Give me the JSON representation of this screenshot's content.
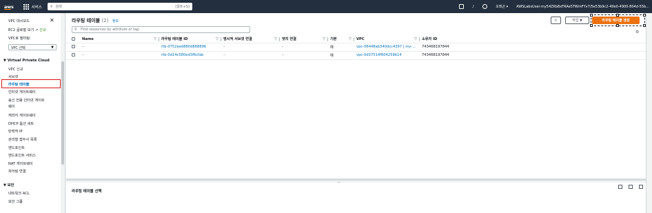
{
  "topbar": {
    "logo": "aws",
    "services_label": "서비스",
    "search_placeholder": "검색",
    "search_shortcut": "[알트+S]",
    "region": "오레곤 ▾",
    "account": "AWSLabsUser-my54ZKb8xFRAe5TWmFYv7/5e53b9c2-49e0-4900-804d-55b..."
  },
  "sidebar": {
    "vpc_dashboard": "VPC 대시보드",
    "ec2_global_view": "EC2 글로벌 보기",
    "new_badge": "신규",
    "filter_label": "VPC로 필터링:",
    "filter_value": "VPC 선택",
    "section_vpc": "Virtual Private Cloud",
    "items": [
      "VPC 신규",
      "서브넷",
      "라우팅 테이블",
      "인터넷 게이트웨이",
      "송신 전용 인터넷 게이트",
      "웨이",
      "캐리어 게이트웨이",
      "DHCP 옵션 세트",
      "탄력적 IP",
      "관리형 접두사 목록",
      "엔드포인트",
      "엔드포인트 서비스",
      "NAT 게이트웨이",
      "피어링 연결"
    ],
    "section_security": "보안",
    "security_items": [
      "네트워크 ACL",
      "보안 그룹"
    ]
  },
  "main": {
    "title": "라우팅 테이블",
    "count": "(2)",
    "info": "정보",
    "filter_placeholder": "Find resources by attribute or tag",
    "actions_label": "작업 ▼",
    "create_label": "라우팅 테이블 생성",
    "pager": "1",
    "columns": [
      "Name",
      "라우팅 테이블 ID",
      "명시적 서브넷 연결",
      "엣지 연결",
      "기본",
      "VPC",
      "소유자 ID"
    ],
    "rows": [
      [
        "–",
        "rtb-0752aed880d868896",
        "–",
        "–",
        "예",
        "vpc-06448ab340dcc4397 | my-...",
        "743468197844"
      ],
      [
        "–",
        "rtb-0d14c580ed3f6cfab",
        "–",
        "–",
        "예",
        "vpc-0d37514f604259b14",
        "743468197844"
      ]
    ]
  },
  "bottom": {
    "title": "라우팅 테이블 선택"
  }
}
